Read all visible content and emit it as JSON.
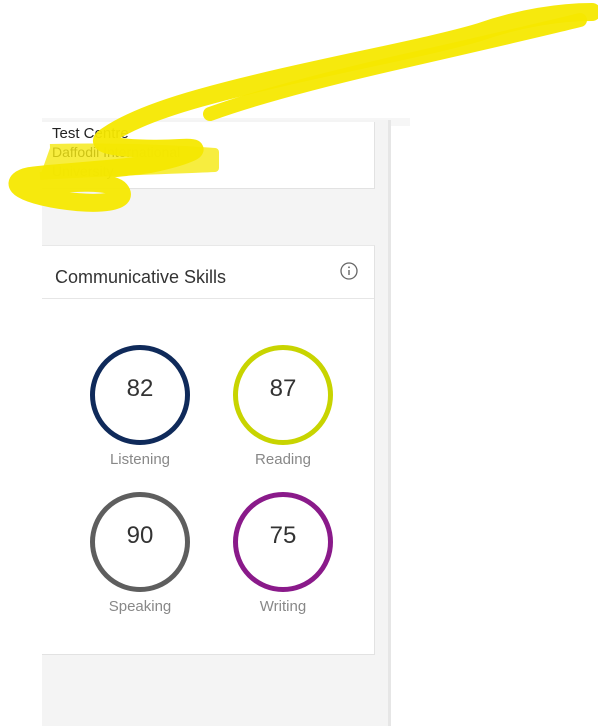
{
  "test_centre": {
    "label": "Test Centre",
    "value": "Daffodil International University"
  },
  "skills_card": {
    "title": "Communicative Skills",
    "info_icon": "info-icon",
    "skills": [
      {
        "name": "Listening",
        "score": "82",
        "color": "#0f2a5a"
      },
      {
        "name": "Reading",
        "score": "87",
        "color": "#c8d400"
      },
      {
        "name": "Speaking",
        "score": "90",
        "color": "#5e5e5e"
      },
      {
        "name": "Writing",
        "score": "75",
        "color": "#8a1a8a"
      }
    ]
  },
  "overlay": {
    "highlight_color": "#f5e800"
  }
}
